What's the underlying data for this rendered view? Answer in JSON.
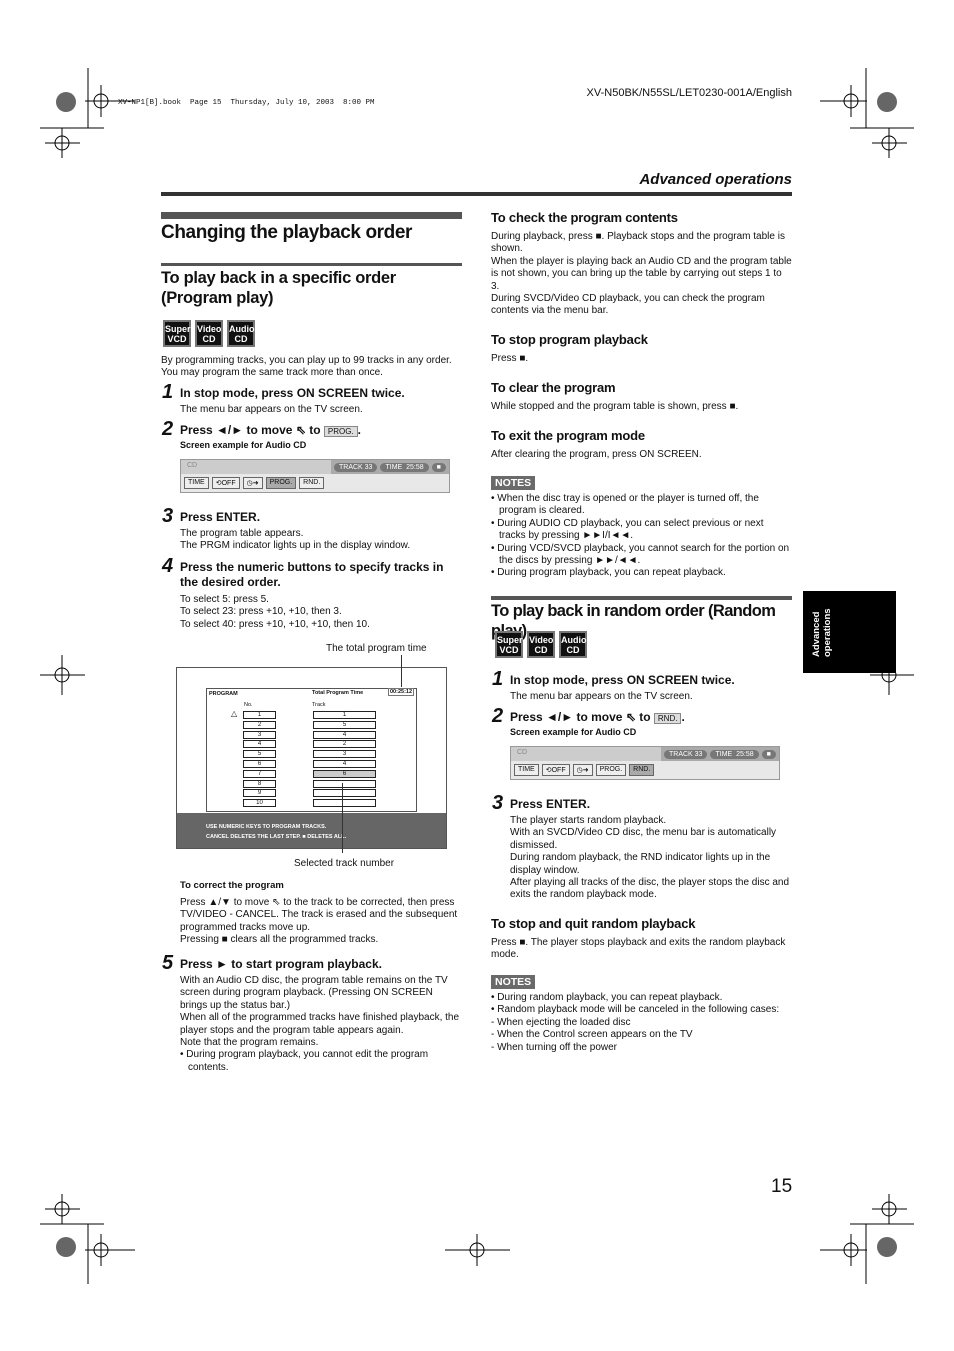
{
  "header": {
    "model": "XV-N50BK/N55SL/LET0230-001A/English",
    "file_stamp": "XV-NP1[B].book  Page 15  Thursday, July 10, 2003  8:00 PM",
    "section": "Advanced operations",
    "page_number": "15",
    "side_tab": "Advanced operations"
  },
  "discs": [
    "Super VCD",
    "Video CD",
    "Audio CD"
  ],
  "left": {
    "title": "Changing the playback order",
    "subtitle": "To play back in a specific order (Program play)",
    "intro": "By programming tracks, you can play up to 99 tracks in any order. You may program the same track more than once.",
    "step1": {
      "num": "1",
      "title": "In stop mode, press ON SCREEN twice.",
      "text": "The menu bar appears on the TV screen."
    },
    "step2": {
      "num": "2",
      "pre": "Press ◄/► to move",
      "to": "to",
      "btn": "PROG.",
      "caption": "Screen example for Audio CD"
    },
    "step3": {
      "num": "3",
      "title": "Press ENTER.",
      "text1": "The program table appears.",
      "text2": "The PRGM indicator lights up in the display window."
    },
    "step4": {
      "num": "4",
      "title": "Press the numeric buttons to specify tracks in the desired order.",
      "lines": [
        "To select 5: press 5.",
        "To select 23: press +10, +10, then 3.",
        "To select 40: press +10, +10, +10, then 10."
      ]
    },
    "callout_top": "The total program time",
    "callout_bottom": "Selected track number",
    "program_table": {
      "tab": "PROGRAM",
      "total_label": "Total Program Time",
      "total_time": "00:25:12",
      "col_no": "No.",
      "col_track": "Track",
      "numbers": [
        "1",
        "2",
        "3",
        "4",
        "5",
        "6",
        "7",
        "8",
        "9",
        "10"
      ],
      "tracks": [
        "1",
        "5",
        "4",
        "2",
        "3",
        "4",
        "6",
        "",
        "",
        ""
      ],
      "message1": "USE NUMERIC KEYS  TO PROGRAM TRACKS.",
      "message2": "CANCEL DELETES THE LAST STEP. ■ DELETES ALL."
    },
    "correct": {
      "title": "To correct the program",
      "text": "Press ▲/▼ to move  ⇖  to the track to be corrected, then press TV/VIDEO - CANCEL. The track is erased and the subsequent programmed tracks move up.",
      "text2": "Pressing ■ clears all the programmed tracks."
    },
    "step5": {
      "num": "5",
      "title": "Press ► to start program playback.",
      "text": "With an Audio CD disc, the program table remains on the TV screen during program playback. (Pressing ON SCREEN brings up the status bar.)",
      "text2": "When all of the programmed tracks have finished playback, the player stops and the program table appears again.",
      "text3": "Note that the program remains.",
      "bullet": "During program playback, you cannot edit the program contents."
    }
  },
  "menubar": {
    "disc": "CD",
    "track": "TRACK 33",
    "time_label": "TIME",
    "time": "25:58",
    "stop": "■",
    "time_btn": "TIME",
    "repeat": "⟲OFF",
    "timer": "◷➜",
    "prog": "PROG.",
    "rnd": "RND."
  },
  "right": {
    "check": {
      "title": "To check the program contents",
      "text": "During playback, press ■. Playback stops and the program table is shown.",
      "text2": "When the player is playing back an Audio CD and the program table is not shown, you can bring up the table by carrying out steps 1 to 3.",
      "text3": "During SVCD/Video CD playback, you can check the program contents via the menu bar."
    },
    "stop": {
      "title": "To stop program playback",
      "text": "Press ■."
    },
    "clear": {
      "title": "To clear the program",
      "text": "While stopped and the program table is shown, press ■."
    },
    "exit": {
      "title": "To exit the program mode",
      "text": "After clearing the program, press ON SCREEN."
    },
    "notes_label": "NOTES",
    "notes": [
      "When the disc tray is opened or the player is turned off, the program is cleared.",
      "During AUDIO CD playback, you can select previous or next tracks by pressing ►►I/I◄◄.",
      "During VCD/SVCD playback, you cannot search for the portion on the discs by pressing ►►/◄◄.",
      "During program playback, you can repeat playback."
    ],
    "random_title": "To play back in random order (Random play)",
    "rstep1": {
      "num": "1",
      "title": "In stop mode, press ON SCREEN twice.",
      "text": "The menu bar appears on the TV screen."
    },
    "rstep2": {
      "num": "2",
      "pre": "Press ◄/► to move",
      "to": "to",
      "btn": "RND.",
      "caption": "Screen example for Audio CD"
    },
    "rstep3": {
      "num": "3",
      "title": "Press ENTER.",
      "lines": [
        "The player starts random playback.",
        "With an SVCD/Video CD disc, the menu bar is automatically dismissed.",
        "During random playback, the RND indicator lights up in the display window.",
        "After playing all tracks of the disc, the player stops the disc and exits the random playback mode."
      ]
    },
    "quit": {
      "title": "To stop and quit random playback",
      "text": "Press ■. The player stops playback and exits the random playback mode."
    },
    "notes2": [
      "• During random playback, you can repeat playback.",
      "• Random playback mode will be canceled in the following cases:",
      "- When ejecting the loaded disc",
      "- When the Control screen appears on the TV",
      "- When turning off the power"
    ]
  }
}
